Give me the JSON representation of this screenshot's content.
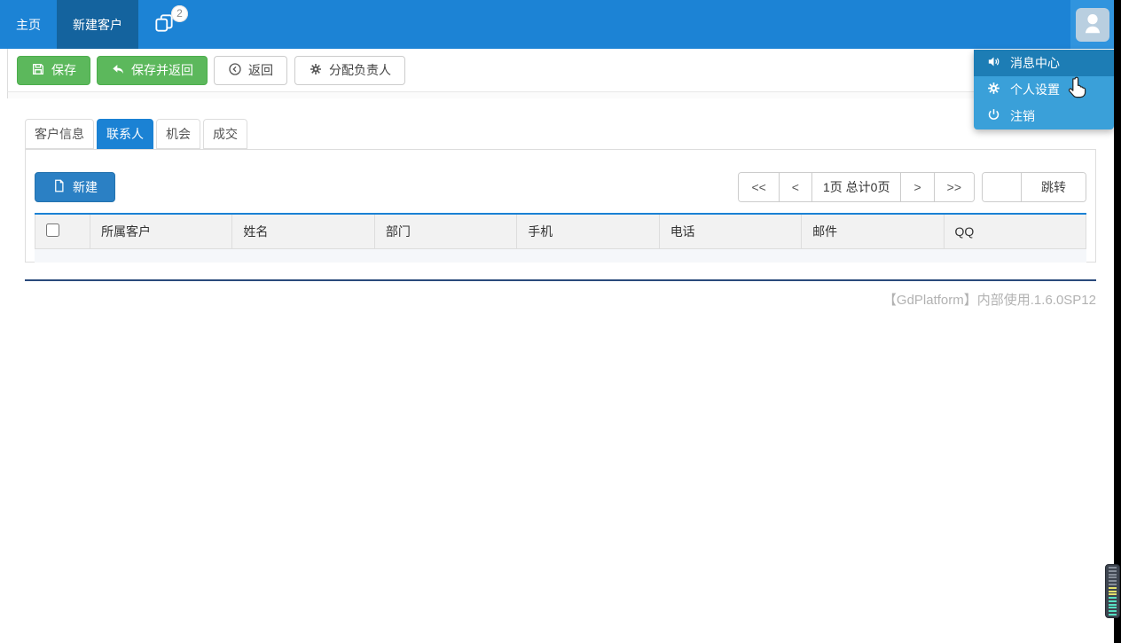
{
  "navbar": {
    "items": [
      {
        "label": "主页"
      },
      {
        "label": "新建客户",
        "active": true
      }
    ],
    "badge_count": "2",
    "icons": {
      "tabs_icon": "windows-stack-icon",
      "avatar": "person-icon"
    }
  },
  "user_menu": {
    "items": [
      {
        "label": "消息中心",
        "icon": "volume-icon",
        "highlighted": true
      },
      {
        "label": "个人设置",
        "icon": "gear-icon"
      },
      {
        "label": "注销",
        "icon": "power-icon"
      }
    ]
  },
  "toolbar": {
    "save_label": "保存",
    "save_return_label": "保存并返回",
    "back_label": "返回",
    "assign_owner_label": "分配负责人",
    "icons": {
      "save": "floppy-icon",
      "save_return": "reply-arrow-icon",
      "back": "circle-left-arrow-icon",
      "assign": "gear-icon"
    }
  },
  "tabs": [
    {
      "label": "客户信息"
    },
    {
      "label": "联系人",
      "active": true
    },
    {
      "label": "机会"
    },
    {
      "label": "成交"
    }
  ],
  "panel": {
    "new_button_label": "新建",
    "new_button_icon": "new-file-icon",
    "pagination": {
      "first": "<<",
      "prev": "<",
      "status": "1页 总计0页",
      "next": ">",
      "last": ">>",
      "jump_value": "",
      "jump_label": "跳转"
    },
    "table": {
      "columns": [
        "所属客户",
        "姓名",
        "部门",
        "手机",
        "电话",
        "邮件",
        "QQ"
      ]
    }
  },
  "footer": {
    "text": "【GdPlatform】内部使用.1.6.0SP12"
  },
  "colors": {
    "navbar_blue": "#1c83d5",
    "navbar_active_blue": "#14639e",
    "dropdown_blue": "#3aa0d9",
    "dropdown_highlight_blue": "#1d7db5",
    "button_green": "#5cb85c",
    "primary_blue": "#2b80c4",
    "grid_header_bg": "#f2f2f2",
    "grid_accent_blue": "#1b82d4",
    "divider_navy": "#2a4a7c",
    "footer_gray": "#b2b2b2"
  }
}
